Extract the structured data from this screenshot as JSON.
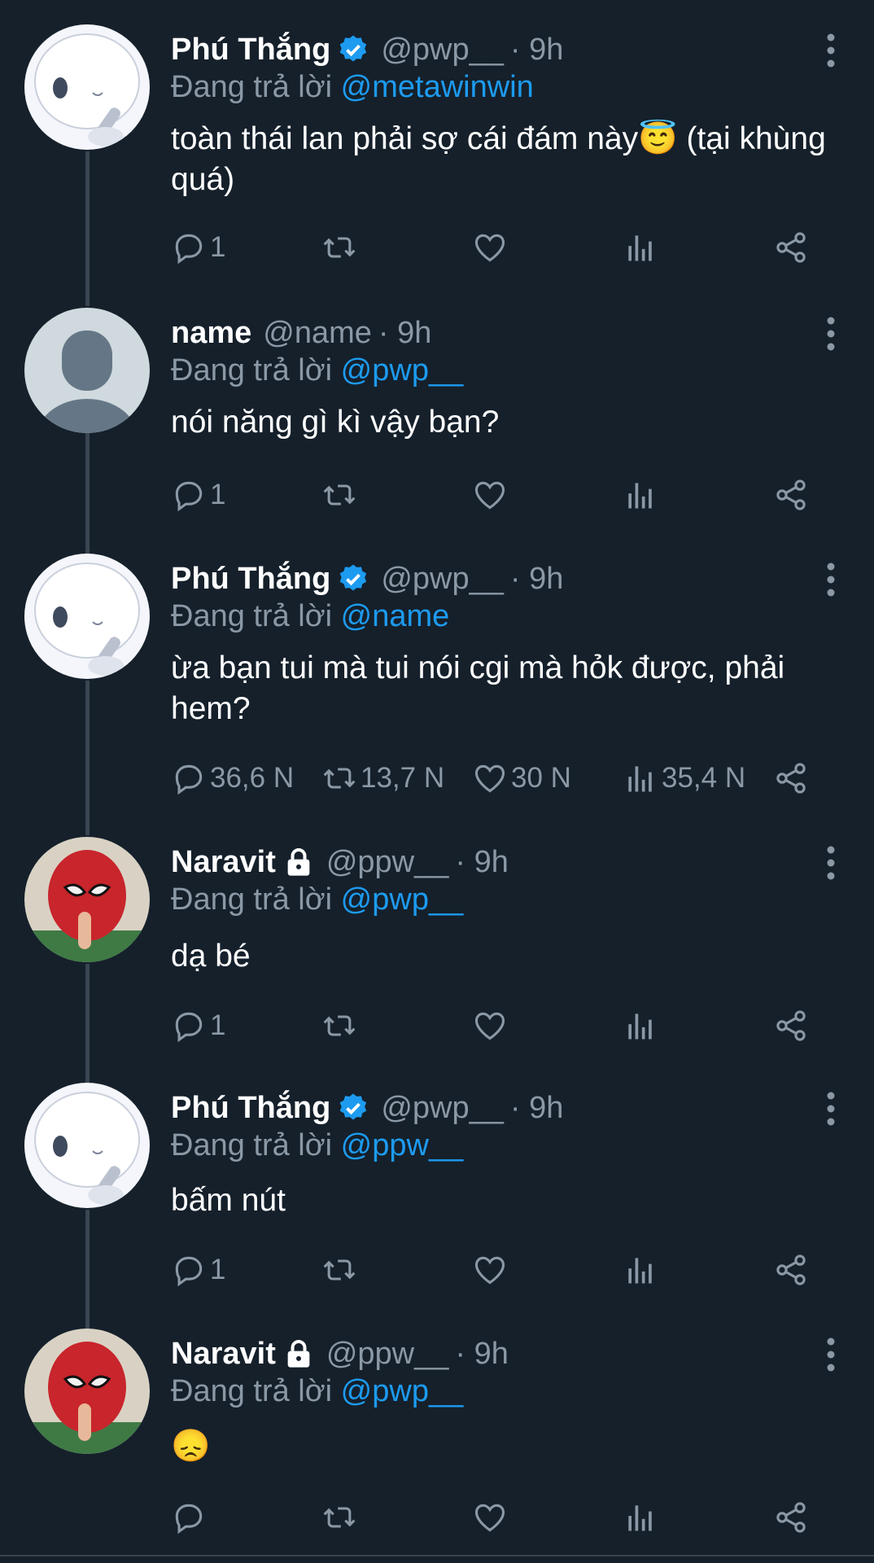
{
  "colors": {
    "background": "#15202b",
    "accent": "#1d9bf0",
    "secondary_text": "#8b98a5"
  },
  "tweets": [
    {
      "name": "Phú Thắng",
      "badge": "verified-icon",
      "handle": "@pwp__",
      "time": "· 9h",
      "replying_prefix": "Đang trả lời",
      "replying_to": "@metawinwin",
      "text": "toàn thái lan phải sợ cái đám này😇 (tại khùng quá)",
      "reply_count": "1",
      "retweet_count": "",
      "like_count": "",
      "view_count": "",
      "avatar": "cartoon-character-avatar"
    },
    {
      "name": "name",
      "badge": "",
      "handle": "@name",
      "time": "· 9h",
      "replying_prefix": "Đang trả lời",
      "replying_to": "@pwp__",
      "text": "nói năng gì kì vậy bạn?",
      "reply_count": "1",
      "retweet_count": "",
      "like_count": "",
      "view_count": "",
      "avatar": "default-user-avatar"
    },
    {
      "name": "Phú Thắng",
      "badge": "verified-icon",
      "handle": "@pwp__",
      "time": "· 9h",
      "replying_prefix": "Đang trả lời",
      "replying_to": "@name",
      "text": "ừa bạn tui mà tui nói cgi mà hỏk được, phải hem?",
      "reply_count": "36,6 N",
      "retweet_count": "13,7 N",
      "like_count": "30 N",
      "view_count": "35,4 N",
      "avatar": "cartoon-character-avatar"
    },
    {
      "name": "Naravit",
      "badge": "lock-icon",
      "handle": "@ppw__",
      "time": "· 9h",
      "replying_prefix": "Đang trả lời",
      "replying_to": "@pwp__",
      "text": "dạ bé",
      "reply_count": "1",
      "retweet_count": "",
      "like_count": "",
      "view_count": "",
      "avatar": "spiderman-mask-avatar"
    },
    {
      "name": "Phú Thắng",
      "badge": "verified-icon",
      "handle": "@pwp__",
      "time": "· 9h",
      "replying_prefix": "Đang trả lời",
      "replying_to": "@ppw__",
      "text": "bấm nút",
      "reply_count": "1",
      "retweet_count": "",
      "like_count": "",
      "view_count": "",
      "avatar": "cartoon-character-avatar"
    },
    {
      "name": "Naravit",
      "badge": "lock-icon",
      "handle": "@ppw__",
      "time": "· 9h",
      "replying_prefix": "Đang trả lời",
      "replying_to": "@pwp__",
      "text": "😞",
      "reply_count": "",
      "retweet_count": "",
      "like_count": "",
      "view_count": "",
      "avatar": "spiderman-mask-avatar"
    }
  ]
}
